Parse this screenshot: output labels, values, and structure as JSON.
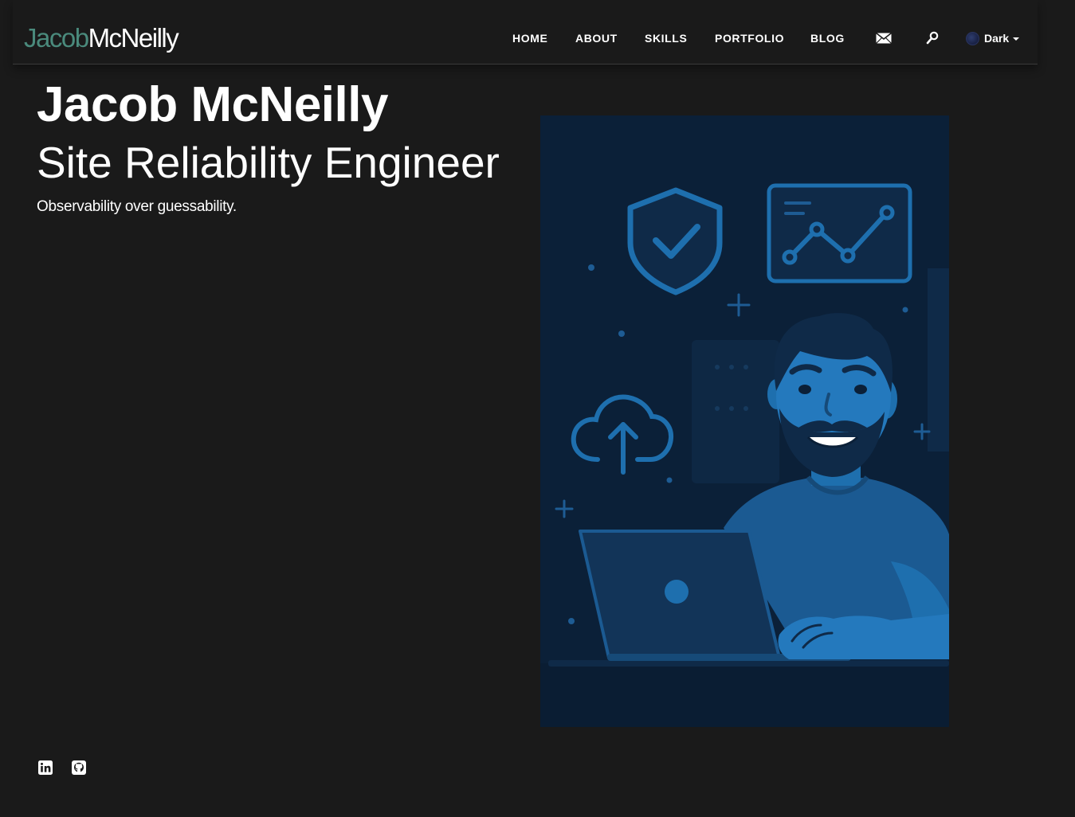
{
  "brand": {
    "first": "Jacob",
    "last": "McNeilly"
  },
  "nav": {
    "items": [
      {
        "label": "HOME"
      },
      {
        "label": "ABOUT"
      },
      {
        "label": "SKILLS"
      },
      {
        "label": "PORTFOLIO"
      },
      {
        "label": "BLOG"
      }
    ],
    "mail_icon": "envelope-icon",
    "search_icon": "magnifier-icon",
    "theme": {
      "label": "Dark",
      "icon": "theme-dot-icon"
    }
  },
  "hero": {
    "name": "Jacob McNeilly",
    "title": "Site Reliability Engineer",
    "tagline": "Observability over guessability.",
    "illustration": "engineer-with-laptop-illustration"
  },
  "social": [
    {
      "icon": "linkedin-icon"
    },
    {
      "icon": "github-icon"
    }
  ],
  "colors": {
    "background": "#1a1a1a",
    "brand_accent": "#4a8a7c",
    "illustration_dark": "#0b2038",
    "illustration_blue": "#1e6fae"
  }
}
